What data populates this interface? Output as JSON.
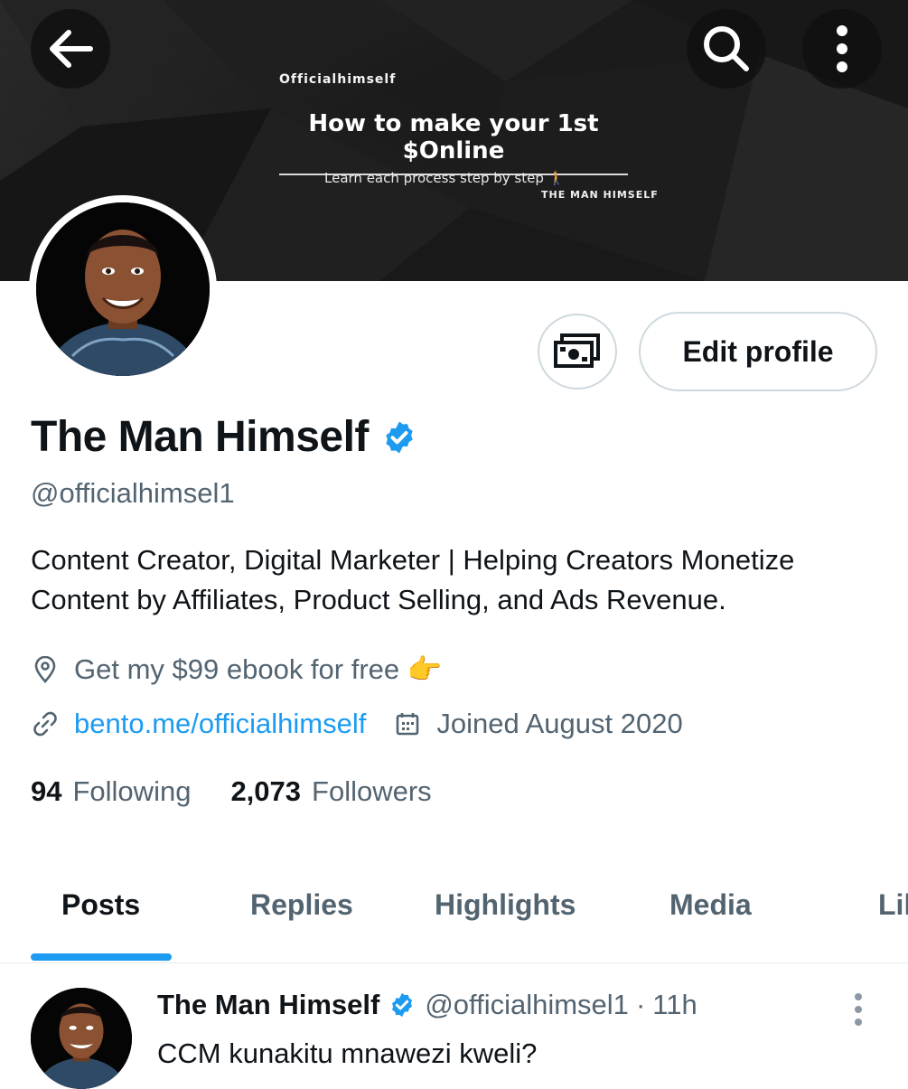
{
  "banner": {
    "brand": "Officialhimself",
    "title": "How to make your 1st $Online",
    "subtitle": "Learn each process step by step 🚶",
    "signature": "THE MAN HIMSELF"
  },
  "header": {
    "back_icon": "back-arrow-icon",
    "search_icon": "search-icon",
    "more_icon": "more-vertical-icon"
  },
  "actions": {
    "tip_icon": "money-icon",
    "edit_label": "Edit profile"
  },
  "profile": {
    "name": "The Man Himself",
    "verified": true,
    "handle": "@officialhimsel1",
    "bio": "Content Creator, Digital Marketer | Helping Creators Monetize Content by Affiliates, Product Selling, and Ads Revenue.",
    "location": "Get my $99 ebook for free 👉",
    "website": "bento.me/officialhimself",
    "joined": "Joined August 2020",
    "following_count": "94",
    "following_label": "Following",
    "followers_count": "2,073",
    "followers_label": "Followers"
  },
  "tabs": [
    {
      "label": "Posts",
      "active": true
    },
    {
      "label": "Replies",
      "active": false
    },
    {
      "label": "Highlights",
      "active": false
    },
    {
      "label": "Media",
      "active": false
    },
    {
      "label": "Likes",
      "active": false
    }
  ],
  "post": {
    "author": "The Man Himself",
    "handle": "@officialhimsel1",
    "separator": "·",
    "time": "11h",
    "text": "CCM kunakitu mnawezi kweli?"
  },
  "colors": {
    "accent": "#1d9bf0",
    "text_primary": "#0f1419",
    "text_secondary": "#536471",
    "border": "#cfd9de",
    "banner_bg": "#1b1b1b"
  }
}
